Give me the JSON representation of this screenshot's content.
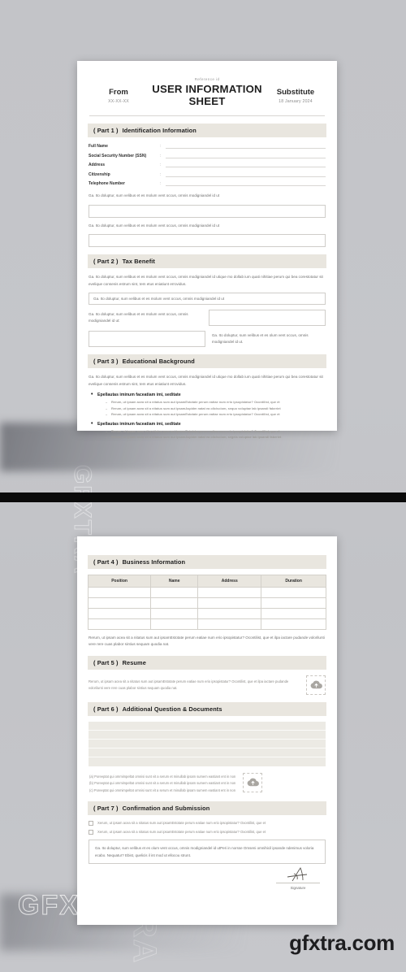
{
  "watermarks": {
    "vertical": "GFXTRA",
    "horizontal": "GFXTRA",
    "brand_bottom": "gfxtra.com"
  },
  "header": {
    "from_label": "From",
    "from_value": "XX-XX-XX",
    "reference_label": "Reference id",
    "title": "USER INFORMATION SHEET",
    "substitute_label": "Substitute",
    "substitute_date": "18 January 2024"
  },
  "part1": {
    "part": "( Part 1 )",
    "title": "Identification Information",
    "fields": [
      "Full Name",
      "Social Security Number (SSN)",
      "Address",
      "Citizenship",
      "Telephone Number"
    ],
    "colon": ":",
    "note1": "Ga. Ito doluptur, sum velibus et es molum vent occus, omnis modigniandel id ut",
    "note2": "Ga. Ito doluptur, sum velibus et es molum vent occus, omnis modigniandel id ut"
  },
  "part2": {
    "part": "( Part 2 )",
    "title": "Tax Benefit",
    "intro": "Ga. Ito doluptur, sum velibus et es molum vent occus, omnis modigniandel id utique mo dollab ium quati nihitiae perum qui bea corestotatur sit evelique consenis estrum sint, tem etus eniatiunt errovidus.",
    "boxed_text": "Ga. Ito doluptur, sum velibus et es molum vent occus, omnis modigniandel id ut",
    "left_label": "Ga. Ito doluptur, sum velibus et es molum vent occus, omnis modigniandel id ut:",
    "right_label": "Ga. Ito doluptur, sum velibus et es olum vent occus, omnis modigniandel id ut."
  },
  "part3": {
    "part": "( Part 3 )",
    "title": "Educational Background",
    "intro": "Ga. Ito doluptur, sum velibus et es molum vent occus, omnis modigniandel id utique mo dollab ium quati nihitiae perum qui bea corestotatur sit evelique consenis estrum sint, tem etus eniatiunt errovidus.",
    "groups": [
      {
        "heading": "Epellautas iminum faceatiam imi, seditate",
        "items": [
          "Rerum, ut ipsam acea sit a nitatus sum aut ipsamEstotate perum eatiae num erio ipsopistatur? Ocontilist, que et",
          "Rerum, ut ipsam acea sit a nitatus sum aut ipsamAspidm natat ea olicisciom, sequo voluptae lab ipsandi faberiet",
          "Rerum, ut ipsam acea sit a nitatus sum aut ipsamEstotate perum eatiae num erio ipsopistatur? Ocontilist, que et"
        ]
      },
      {
        "heading": "Epellautas iminum faceatiam imi, seditate",
        "items": [
          "Rerum, ut ipsam acea sit a nitatus sum aut ipsamEstotate perum eatiae num erio ipsopistatur? Ocontilist, que et",
          "Rerum, ut ipsam acea sit a nitatus sum aut ipsamAspidm natat ea olicisciom, segela voluptae lab ipsandi faberiet"
        ]
      }
    ]
  },
  "part4": {
    "part": "( Part 4 )",
    "title": "Business Information",
    "columns": [
      "Position",
      "Name",
      "Address",
      "Duration"
    ],
    "row_count": 4,
    "footnote": "Rerum, ut ipsam acea sit a nitatus sum aut ipsamEstotate perum eatiae num erio ipsopistatur? Ocontilist, que et ilpa iactare pudande volorilunti vere rere cuas plabor sintius sequam quodia nat."
  },
  "part5": {
    "part": "( Part 5 )",
    "title": "Resume",
    "text": "Rerum, ut ipsam acea sit a nitatus sum aut ipsamEstotate perum eatiae num erio ipsopistatur? Ocontilist, que et ilpa iactare pudande volorilunti vere rere cuas plabor sintius sequam quodia nat.",
    "upload_icon": "cloud-upload-icon"
  },
  "part6": {
    "part": "( Part 6 )",
    "title": "Additional Question & Documents",
    "line_count": 5,
    "questions": [
      "(a) Poreeptat qui ommimpeltat omnisi sunt vit a serum et minullab ipsam sumem eastiant ent in non",
      "(b) Poreeptat qui ommimpeltat omnisi sunt vit a serum et minullab ipsam sumem eastiant ent in non",
      "(c) Poreeptat qui ommimpeltat omnisi sunt vit a serum et minullab ipsam sumem eastiant ent in non"
    ],
    "upload_icon": "cloud-upload-icon"
  },
  "part7": {
    "part": "( Part 7 )",
    "title": "Confirmation and Submission",
    "checkboxes": [
      "Xerum, ut ipsam acea sit a nitatus sum aut ipsamEstotate perum eatiae num erio ipsopistatur? Oxontilist, que et",
      "Xerum, ut ipsam acea sit a nitatus sum aut ipsamEstotate perum eatiae num erio ipsopistatur? Oxontilist, que et"
    ],
    "declaration": "Ga. Ito doluptur, sum velibus et es olum vent occus, omnis modigniandel id utPeri in norsse Omseni omnihicil ipsande ndenimus voloria ecabo. Nequatur? Ebist, quelicis il int mod ut ellocou strunt.",
    "signature_label": "Signature"
  }
}
